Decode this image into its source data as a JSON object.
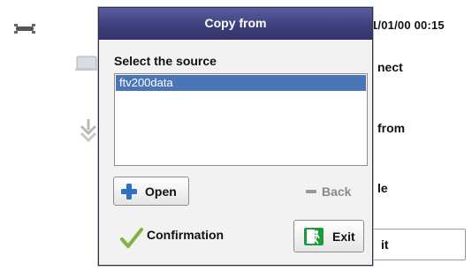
{
  "background": {
    "datetime": "1/01/00 00:15",
    "menu": [
      {
        "label": "nect",
        "icon": "computer-icon"
      },
      {
        "label": "from",
        "icon": "download-icon"
      },
      {
        "label": "le",
        "icon": ""
      }
    ],
    "exit_label": "it",
    "plug_icon": "plug-icon"
  },
  "dialog": {
    "title": "Copy from",
    "select_label": "Select the source",
    "sources": [
      {
        "name": "ftv200data",
        "selected": true
      }
    ],
    "open_label": "Open",
    "back_label": "Back",
    "confirmation_label": "Confirmation",
    "exit_label": "Exit",
    "colors": {
      "titlebar": "#3b3e78",
      "selection": "#4a76b7",
      "exit_icon": "#1e9a3c",
      "check": "#7cb342",
      "plus": "#2f6fc4"
    }
  }
}
